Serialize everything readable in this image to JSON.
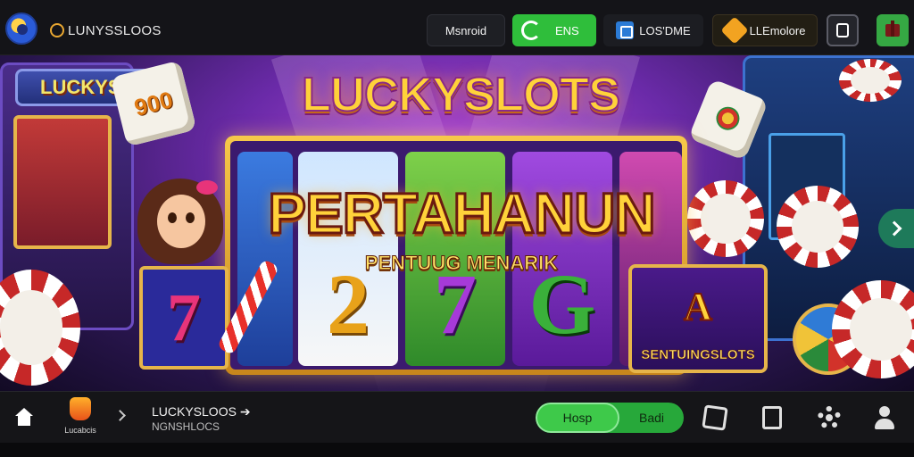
{
  "topbar": {
    "brand_text": "LUNYSSLOOS",
    "btn_dark_label": "Msnroid",
    "btn_green_label": "ENS",
    "btn_vs_label": "LOS'DME",
    "btn_gold_label": "LLEmolore",
    "icons": [
      "app-logo-icon",
      "refresh-icon",
      "square-app-icon",
      "gem-icon",
      "wallet-icon",
      "gift-icon"
    ]
  },
  "hero": {
    "marquee_label": "LUCKYSL",
    "die_label": "900",
    "logo_title": "LUCKYSLOTS",
    "main_title": "PERTAHANUN",
    "subtitle": "PENTUUG MENARIK",
    "reel_symbols": [
      "7",
      "2",
      "7",
      "G"
    ],
    "side_reel_symbol": "7",
    "badge_art": "A",
    "badge_label": "SENTUINGSLOTS"
  },
  "bottombar": {
    "nav_logo_text": "Lucabcis",
    "crumb_title": "LUCKYSLOOS ➔",
    "crumb_sub": "NGNSHLOCS",
    "pill_left": "Hosp",
    "pill_right": "Badi",
    "icons": [
      "home-icon",
      "chevron-right-icon",
      "puzzle-icon",
      "document-icon",
      "gear-icon",
      "user-icon"
    ]
  },
  "colors": {
    "accent_green": "#3ec94a",
    "gold": "#ffd23a",
    "purple_bg": "#6a2aa8"
  }
}
